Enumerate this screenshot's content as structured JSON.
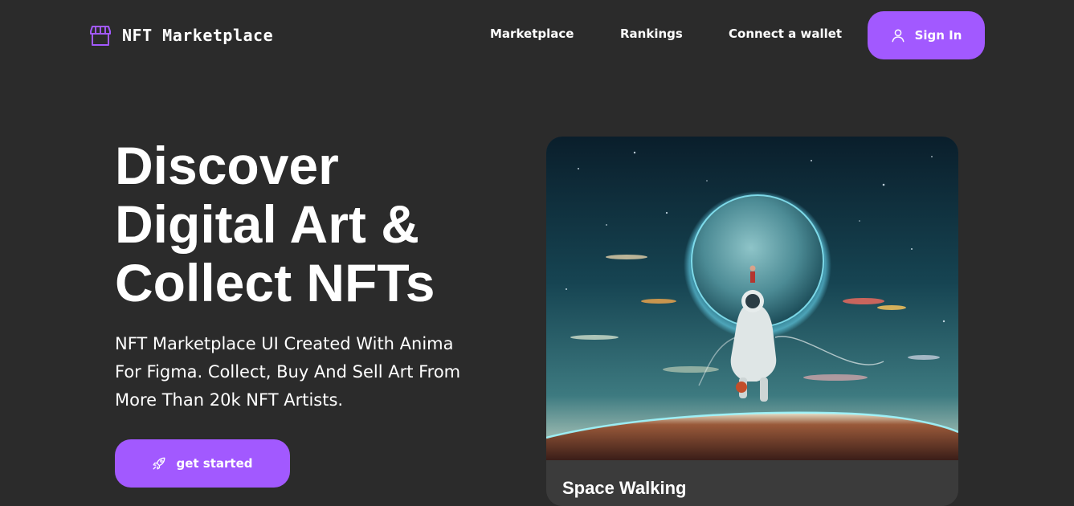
{
  "brand": {
    "name": "NFT Marketplace",
    "icon": "storefront-icon",
    "accent": "#a259ff"
  },
  "nav": {
    "items": [
      {
        "label": "Marketplace"
      },
      {
        "label": "Rankings"
      },
      {
        "label": "Connect a wallet"
      }
    ],
    "signin": {
      "label": "Sign In",
      "icon": "user-icon"
    }
  },
  "hero": {
    "title_lines": [
      "Discover",
      "Digital Art &",
      "Collect NFTs"
    ],
    "subtitle_lines": [
      "NFT Marketplace UI Created With Anima",
      "For Figma. Collect, Buy And Sell Art From",
      "More Than 20k NFT Artists."
    ],
    "cta": {
      "label": "get started",
      "icon": "rocket-icon"
    }
  },
  "featured": {
    "title": "Space Walking"
  },
  "colors": {
    "background": "#2b2b2b",
    "card": "#3b3b3b",
    "accent": "#a259ff",
    "text": "#ffffff"
  }
}
